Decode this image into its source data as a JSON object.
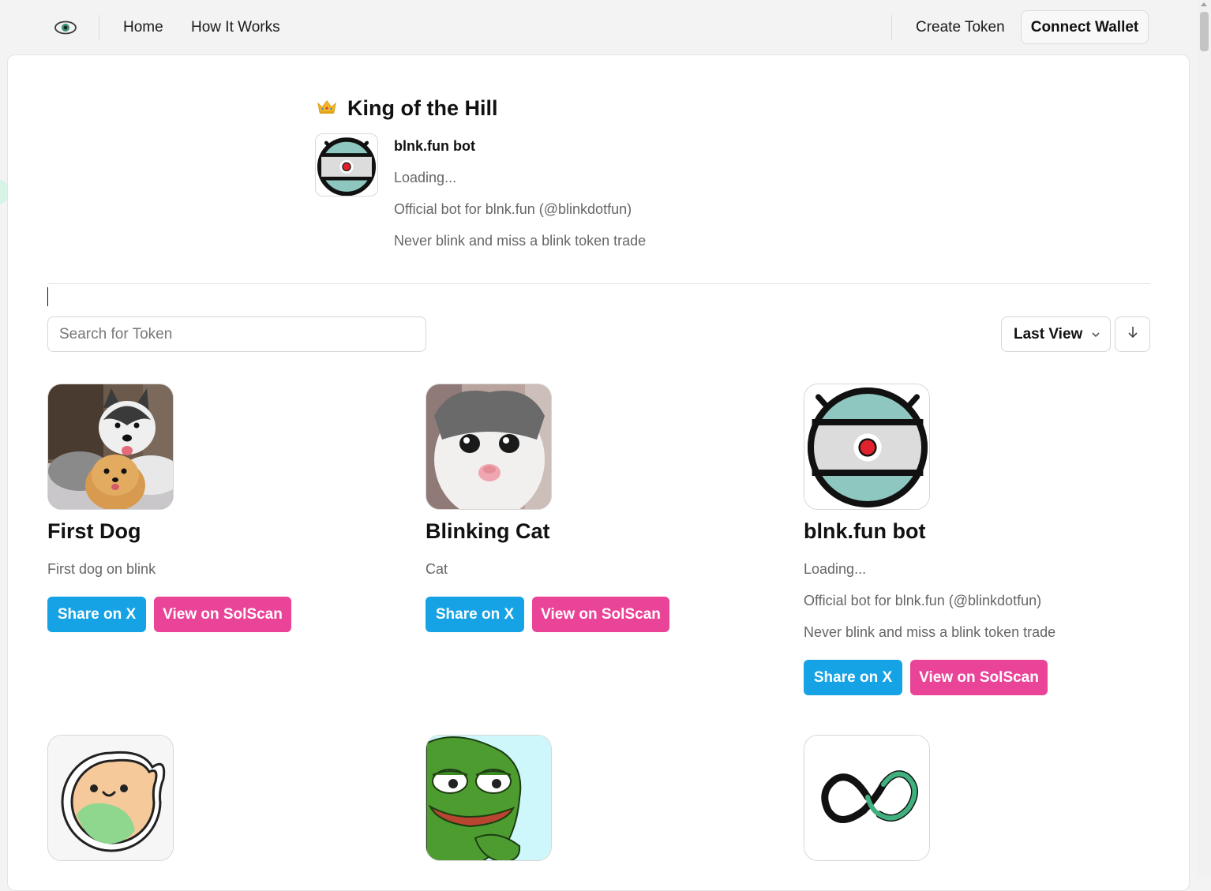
{
  "nav": {
    "links": [
      "Home",
      "How It Works"
    ],
    "create_token": "Create Token",
    "connect_wallet": "Connect Wallet"
  },
  "koth": {
    "title": "King of the Hill",
    "name": "blnk.fun bot",
    "lines": [
      "Loading...",
      "Official bot for blnk.fun (@blinkdotfun)",
      "Never blink and miss a blink token trade"
    ]
  },
  "search": {
    "placeholder": "Search for Token"
  },
  "sort": {
    "label": "Last View"
  },
  "buttons": {
    "share": "Share on X",
    "solscan": "View on SolScan"
  },
  "tokens": [
    {
      "name": "First Dog",
      "desc": [
        "First dog on blink"
      ]
    },
    {
      "name": "Blinking Cat",
      "desc": [
        "Cat"
      ]
    },
    {
      "name": "blnk.fun bot",
      "desc": [
        "Loading...",
        "Official bot for blnk.fun (@blinkdotfun)",
        "Never blink and miss a blink token trade"
      ]
    }
  ],
  "colors": {
    "share": "#16a3e6",
    "solscan": "#ea4498"
  }
}
